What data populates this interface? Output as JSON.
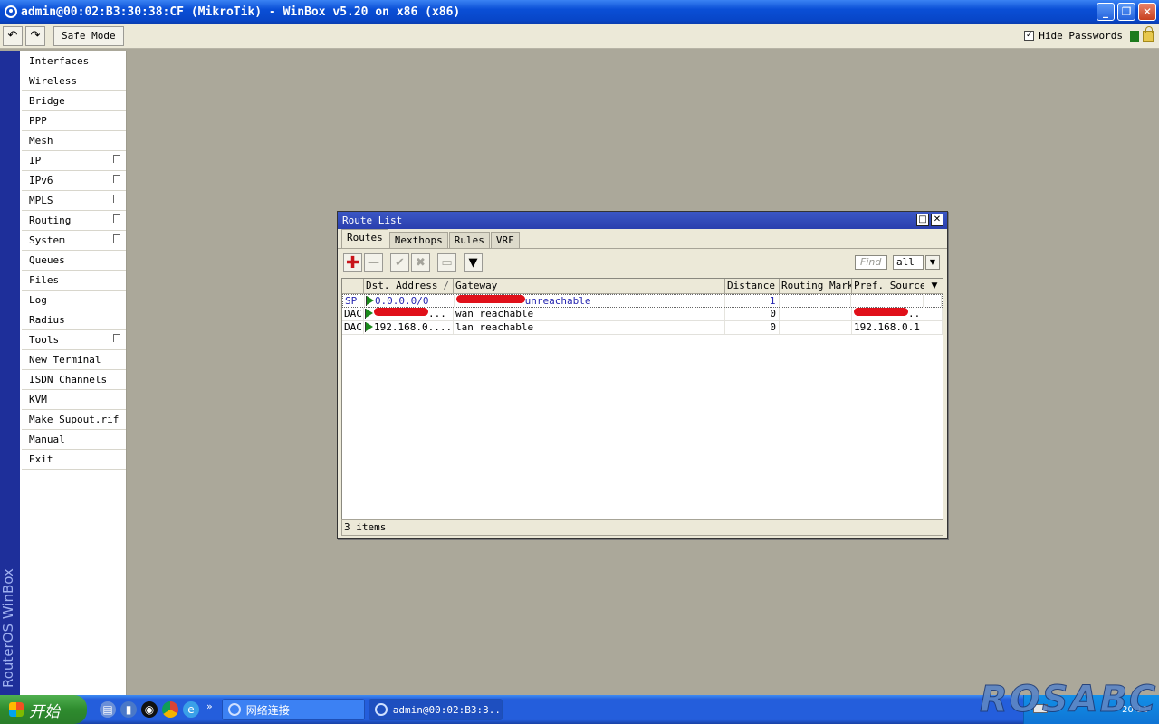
{
  "window": {
    "title": "admin@00:02:B3:30:38:CF (MikroTik) - WinBox v5.20 on x86 (x86)",
    "min_glyph": "_",
    "max_glyph": "❐",
    "close_glyph": "✕"
  },
  "toolbar": {
    "undo_glyph": "↶",
    "redo_glyph": "↷",
    "safe_mode_label": "Safe Mode",
    "hide_passwords_label": "Hide Passwords",
    "hide_passwords_checked": "✓"
  },
  "brand": {
    "vertical_text": "RouterOS WinBox"
  },
  "menu": {
    "items": [
      "Interfaces",
      "Wireless",
      "Bridge",
      "PPP",
      "Mesh",
      "IP",
      "IPv6",
      "MPLS",
      "Routing",
      "System",
      "Queues",
      "Files",
      "Log",
      "Radius",
      "Tools",
      "New Terminal",
      "ISDN Channels",
      "KVM",
      "Make Supout.rif",
      "Manual",
      "Exit"
    ]
  },
  "route_window": {
    "title": "Route List",
    "tabs": [
      "Routes",
      "Nexthops",
      "Rules",
      "VRF"
    ],
    "tools": {
      "add_glyph": "✚",
      "remove_glyph": "—",
      "enable_glyph": "✔",
      "disable_glyph": "✖",
      "comment_glyph": "▭",
      "filter_glyph": "▼"
    },
    "find_placeholder": "Find",
    "filter_value": "all",
    "columns": [
      "",
      "Dst. Address",
      "Gateway",
      "Distance",
      "Routing Mark",
      "Pref. Source"
    ],
    "sort_indicator": "/",
    "rows": [
      {
        "flags": "SP",
        "dst": "0.0.0.0/0",
        "gateway": "unreachable",
        "distance": "1",
        "mark": "",
        "pref": ""
      },
      {
        "flags": "DAC",
        "dst": "...",
        "gateway": "wan reachable",
        "distance": "0",
        "mark": "",
        "pref": ".."
      },
      {
        "flags": "DAC",
        "dst": "192.168.0....",
        "gateway": "lan reachable",
        "distance": "0",
        "mark": "",
        "pref": "192.168.0.1"
      }
    ],
    "status": "3 items"
  },
  "taskbar": {
    "start_label": "开始",
    "tasks": [
      "网络连接",
      "admin@00:02:B3:3..."
    ],
    "clock": "20:11"
  },
  "watermark": "ROSABC",
  "colors": {
    "titlebar": "#0a4fd6",
    "sidebar_brand": "#1e2f9a",
    "route_title": "#2a3fae",
    "redact": "#e0101a"
  }
}
